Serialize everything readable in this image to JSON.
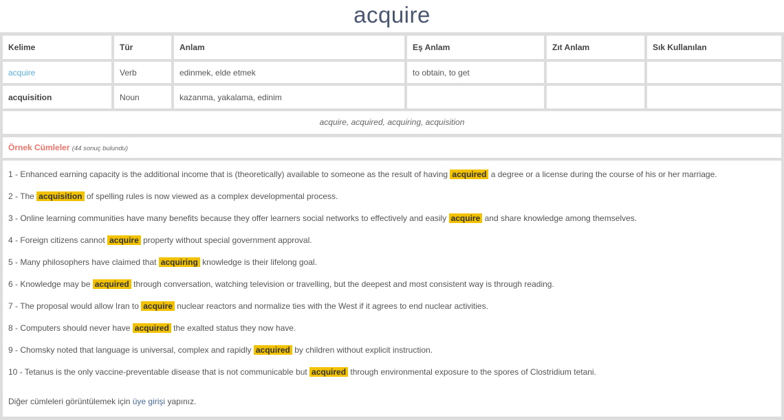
{
  "title": "acquire",
  "table": {
    "headers": [
      "Kelime",
      "Tür",
      "Anlam",
      "Eş Anlam",
      "Zıt Anlam",
      "Sık Kullanılan"
    ],
    "rows": [
      {
        "word": "acquire",
        "type": "Verb",
        "meaning": "edinmek, elde etmek",
        "synonym": "to obtain, to get",
        "antonym": "",
        "frequent": ""
      },
      {
        "word": "acquisition",
        "type": "Noun",
        "meaning": "kazanma, yakalama, edinim",
        "synonym": "",
        "antonym": "",
        "frequent": ""
      }
    ]
  },
  "variants": "acquire, acquired, acquiring, acquisition",
  "examples": {
    "heading": "Örnek Cümleler",
    "count": "(44 sonuç bulundu)",
    "highlight_color": "#f2c200",
    "sentences": [
      {
        "pre": "1 - Enhanced earning capacity is the additional income that is (theoretically) available to someone as the result of having",
        "hl": "acquired",
        "post": "a degree or a license during the course of his or her marriage."
      },
      {
        "pre": "2 - The",
        "hl": "acquisition",
        "post": "of spelling rules is now viewed as a complex developmental process."
      },
      {
        "pre": "3 - Online learning communities have many benefits because they offer learners social networks to effectively and easily",
        "hl": "acquire",
        "post": "and share knowledge among themselves."
      },
      {
        "pre": "4 - Foreign citizens cannot",
        "hl": "acquire",
        "post": "property without special government approval."
      },
      {
        "pre": "5 - Many philosophers have claimed that",
        "hl": "acquiring",
        "post": "knowledge is their lifelong goal."
      },
      {
        "pre": "6 - Knowledge may be",
        "hl": "acquired",
        "post": "through conversation, watching television or travelling, but the deepest and most consistent way is through reading."
      },
      {
        "pre": "7 - The proposal would allow Iran to",
        "hl": "acquire",
        "post": "nuclear reactors and normalize ties with the West if it agrees to end nuclear activities."
      },
      {
        "pre": "8 - Computers should never have",
        "hl": "acquired",
        "post": "the exalted status they now have."
      },
      {
        "pre": "9 - Chomsky noted that language is universal, complex and rapidly",
        "hl": "acquired",
        "post": "by children without explicit instruction."
      },
      {
        "pre": "10 - Tetanus is the only vaccine-preventable disease that is not communicable but",
        "hl": "acquired",
        "post": "through environmental exposure to the spores of Clostridium tetani."
      }
    ],
    "footer_pre": "Diğer cümleleri görüntülemek için",
    "footer_link": "üye girişi",
    "footer_post": "yapınız."
  }
}
